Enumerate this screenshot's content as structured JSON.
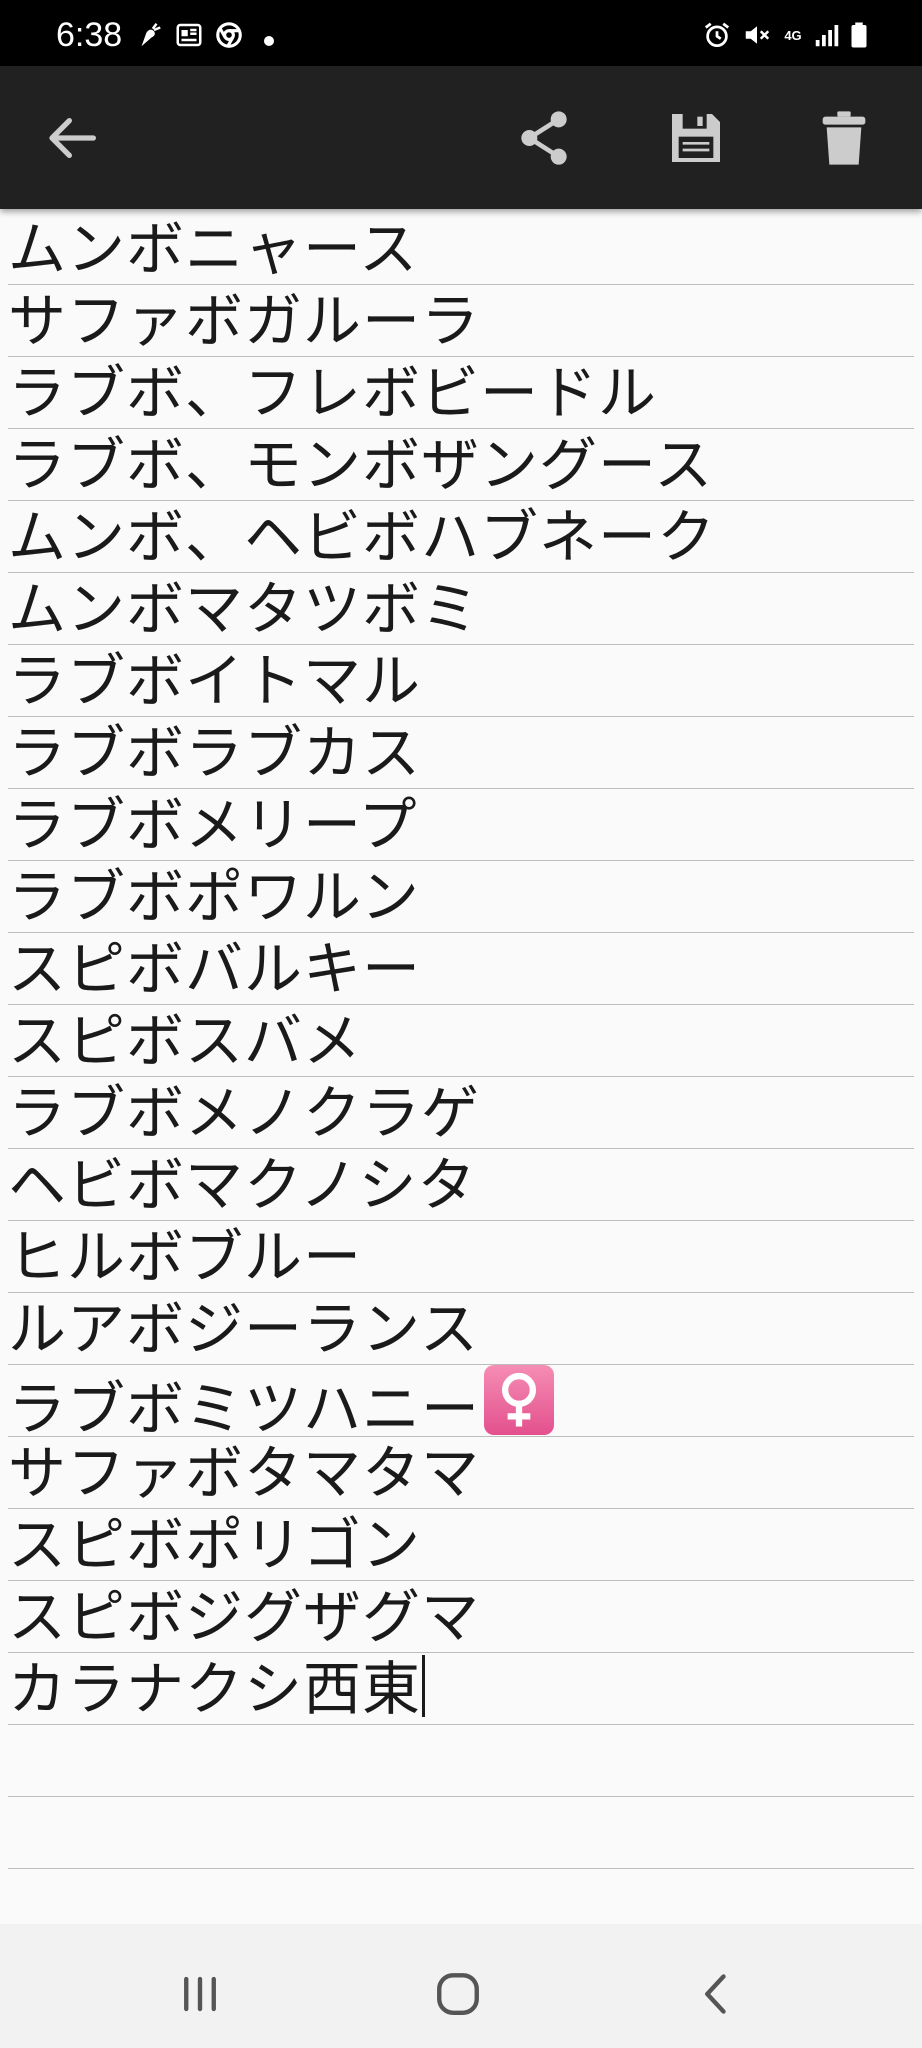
{
  "status_bar": {
    "time": "6:38",
    "network_label": "4G",
    "left_icons": [
      "carrot-notification-icon",
      "news-notification-icon",
      "chrome-notification-icon",
      "more-notifications-dot"
    ],
    "right_icons": [
      "alarm-icon",
      "mute-icon",
      "4g-data-icon",
      "signal-icon",
      "battery-icon"
    ]
  },
  "toolbar": {
    "back_icon": "arrow-back-icon",
    "share_icon": "share-icon",
    "save_icon": "floppy-disk-icon",
    "delete_icon": "trash-icon",
    "background_color": "#212121",
    "icon_color": "#cccccc"
  },
  "note": {
    "lines": [
      "ムンボニャース",
      "サファボガルーラ",
      "ラブボ、フレボビードル",
      "ラブボ、モンボザングース",
      "ムンボ、ヘビボハブネーク",
      "ムンボマタツボミ",
      "ラブボイトマル",
      "ラブボラブカス",
      "ラブボメリープ",
      "ラブボポワルン",
      "スピボバルキー",
      "スピボスバメ",
      "ラブボメノクラゲ",
      "ヘビボマクノシタ",
      "ヒルボブルー",
      "ルアボジーランス",
      "ラブボミツハニー",
      "サファボタマタマ",
      "スピボポリゴン",
      "スピボジグザグマ",
      "カラナクシ西東",
      "",
      ""
    ],
    "emoji_line_index": 16,
    "emoji_name": "female-sign-emoji",
    "cursor_line_index": 20,
    "line_color": "#bdbdbd",
    "text_color": "#1a1a1a"
  },
  "nav_bar": {
    "recents_icon": "recents-icon",
    "home_icon": "home-icon",
    "back_icon": "nav-back-icon"
  }
}
